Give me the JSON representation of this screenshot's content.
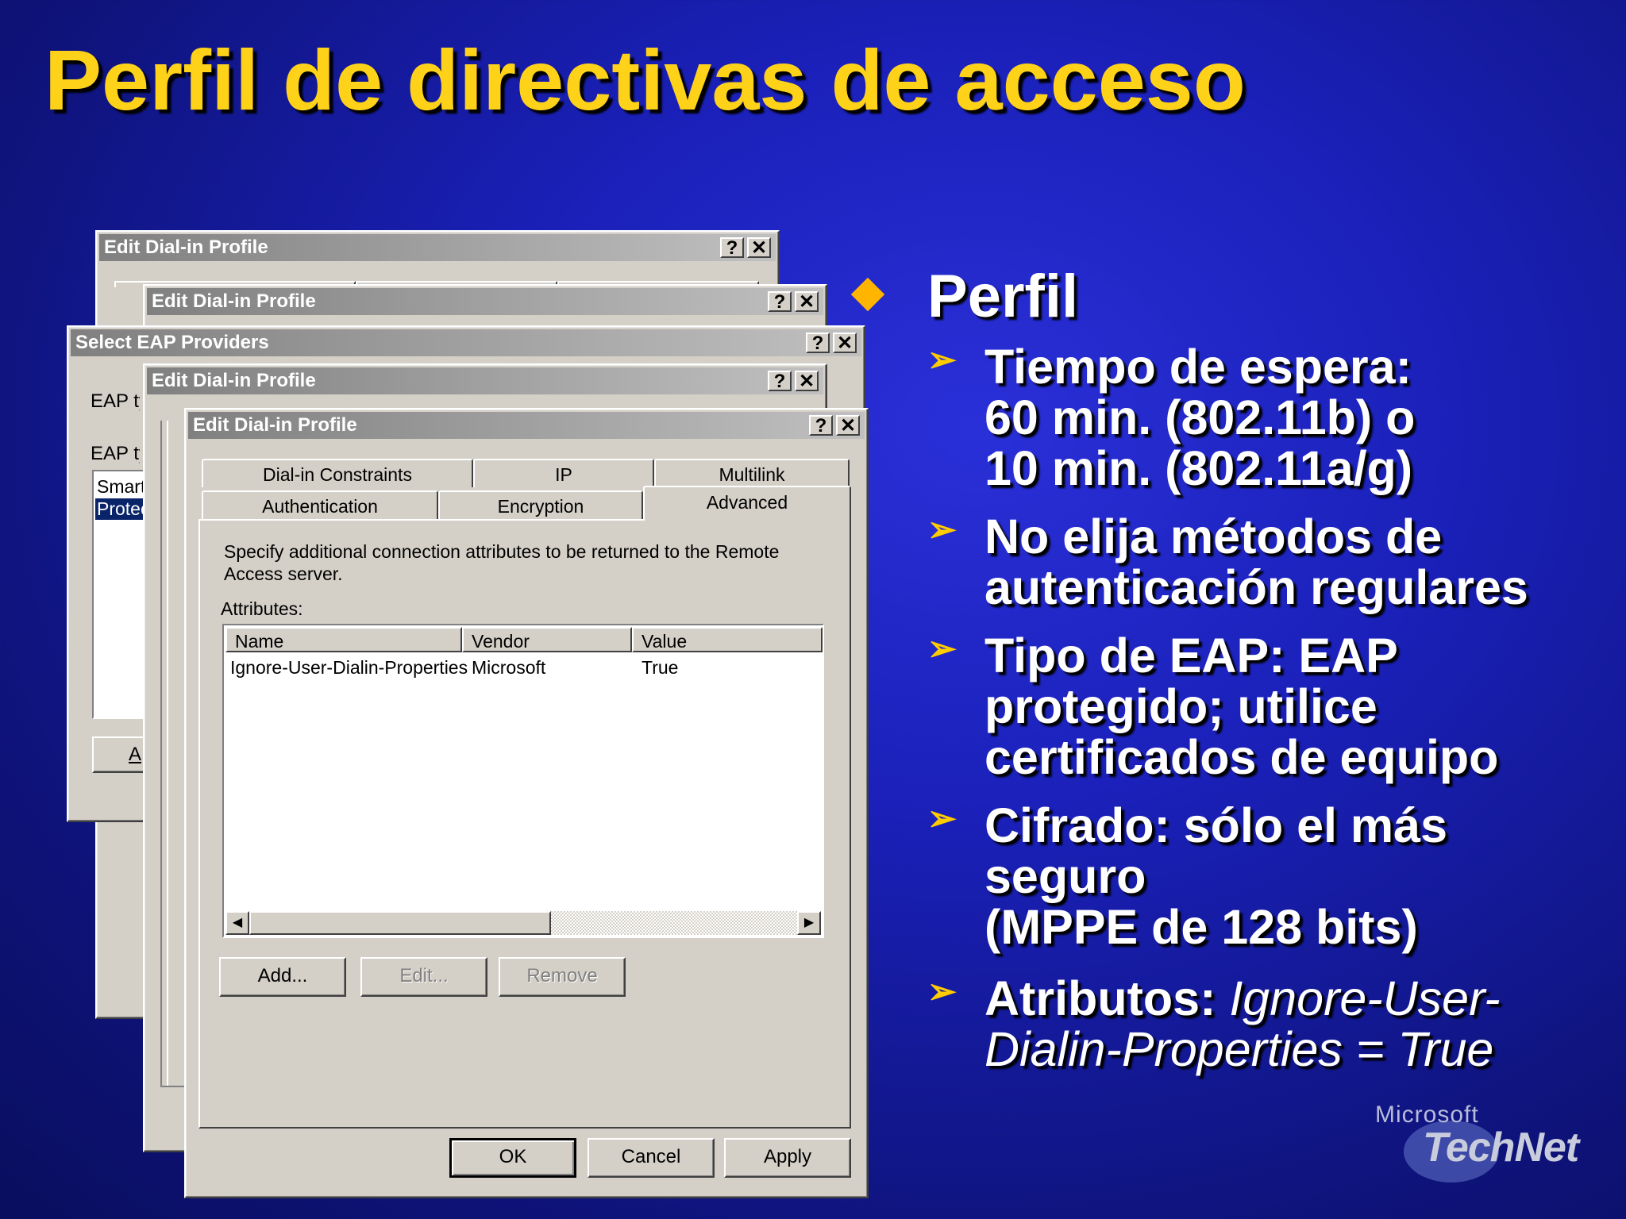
{
  "slide": {
    "title": "Perfil de directivas de acceso"
  },
  "dialogs": {
    "back1_title": "Edit Dial-in Profile",
    "back2_title": "Edit Dial-in Profile",
    "eap_title": "Select EAP Providers",
    "back3_title": "Edit Dial-in Profile",
    "front_title": "Edit Dial-in Profile",
    "help_glyph": "?",
    "close_glyph": "✕",
    "eap_label_1": "EAP ty",
    "eap_label_2": "EAP ty",
    "eap_list_item_1": "Smart",
    "eap_list_item_2": "Protec",
    "eap_button_partial": "A"
  },
  "front_dialog": {
    "tabs_row1": [
      "Dial-in Constraints",
      "IP",
      "Multilink"
    ],
    "tabs_row2": [
      "Authentication",
      "Encryption",
      "Advanced"
    ],
    "active_tab": "Advanced",
    "description": "Specify additional connection attributes to be returned to the Remote Access server.",
    "description_line1": "Specify additional connection attributes to be returned to the Remote",
    "description_line2": "Access server.",
    "attributes_label": "Attributes:",
    "columns": [
      "Name",
      "Vendor",
      "Value"
    ],
    "rows": [
      {
        "name": "Ignore-User-Dialin-Properties",
        "vendor": "Microsoft",
        "value": "True"
      }
    ],
    "buttons": {
      "add": "Add...",
      "edit": "Edit...",
      "remove": "Remove",
      "ok": "OK",
      "cancel": "Cancel",
      "apply": "Apply"
    }
  },
  "bullets": {
    "main": "Perfil",
    "items": [
      {
        "lines": [
          "Tiempo de espera:",
          "60 min. (802.11b) o",
          "10 min. (802.11a/g)"
        ]
      },
      {
        "lines": [
          "No elija métodos de",
          "autenticación regulares"
        ]
      },
      {
        "lines": [
          "Tipo de EAP: EAP",
          "protegido; utilice",
          "certificados de equipo"
        ]
      },
      {
        "lines": [
          "Cifrado: sólo el más",
          "seguro",
          "(MPPE de 128 bits)"
        ]
      },
      {
        "label": "Atributos: ",
        "italic_1": "Ignore-User-",
        "italic_2": "Dialin-Properties = True"
      }
    ]
  },
  "logo": {
    "line1": "Microsoft",
    "line2": "TechNet"
  },
  "colors": {
    "title": "#ffd21a",
    "bullet_diamond": "#ffb400",
    "bullet_arrow": "#ffcc00",
    "background": "#1a20b8",
    "dialog_face": "#d4d0c8",
    "titlebar_inactive": "#808080"
  }
}
